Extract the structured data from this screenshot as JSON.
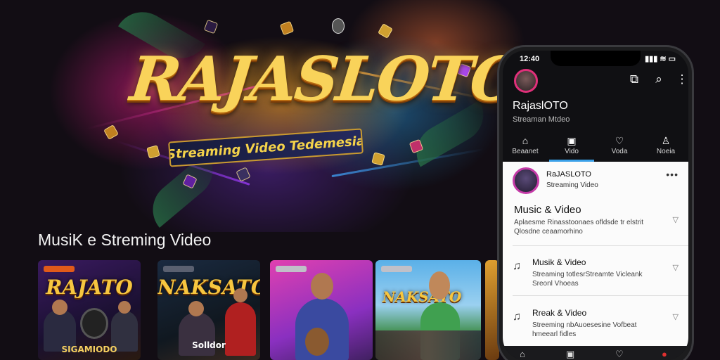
{
  "hero": {
    "logo": "RAJASLOTO",
    "tagline": "Streaming Video Tedemesia"
  },
  "section": {
    "title": "MusiK e Streming Video"
  },
  "cards": [
    {
      "art": "RAJATO",
      "caption": "SIGAMIODO"
    },
    {
      "art": "NAKSATO",
      "caption": "Solldor"
    },
    {
      "art": "",
      "caption": ""
    },
    {
      "art": "NAKSATO",
      "caption": ""
    }
  ],
  "phone": {
    "status_time": "12:40",
    "status_icons": "▮▮▮ ≋ ▭",
    "channel_title": "RajaslOTO",
    "channel_sub": "Streaman Mtdeo",
    "top_icons": [
      "cast-icon",
      "search-icon",
      "more-icon"
    ],
    "tabs": [
      {
        "label": "Beaanet",
        "icon": "home-icon"
      },
      {
        "label": "Vido",
        "icon": "video-icon"
      },
      {
        "label": "Voda",
        "icon": "heart-icon"
      },
      {
        "label": "Noeia",
        "icon": "profile-icon"
      }
    ],
    "post": {
      "name": "RaJASLOTO",
      "sub": "Streaming Video",
      "more": "•••"
    },
    "items": [
      {
        "title": "Music & Video",
        "desc1": "Aplaesme Rinasstoonaes ofldsde   tr elstrit",
        "desc2": "Qlosdne ceaamorhino"
      },
      {
        "title": "Musik & Video",
        "desc1": "Streaming totlesrStreamte Vicleank",
        "desc2": "Sreonl Vhoeas"
      },
      {
        "title": "Rreak & Video",
        "desc1": "Streeming nbAuoesesine Vofbeat",
        "desc2": "hmeearl fidles"
      }
    ]
  }
}
